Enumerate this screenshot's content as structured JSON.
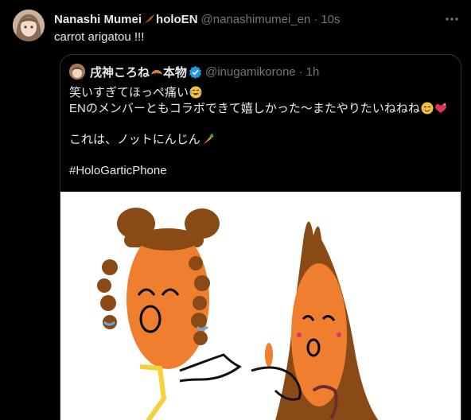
{
  "tweet": {
    "author_name": "Nanashi Mumei",
    "author_suffix": "holoEN",
    "handle": "@nanashimumei_en",
    "separator": "·",
    "time": "10s",
    "text": "carrot arigatou !!!"
  },
  "quote": {
    "author_name": "戌神ころね",
    "author_suffix": "本物",
    "handle": "@inugamikorone",
    "separator": "·",
    "time": "1h",
    "lines": [
      "笑いすぎてほっぺ痛い",
      "ENのメンバーともコラボできて嬉しかった～またやりたいねねね",
      "",
      "これは、ノットにんじん",
      "",
      "#HoloGarticPhone"
    ]
  },
  "colors": {
    "background": "#000000",
    "text": "#e7e9ea",
    "muted": "#71767b",
    "border": "#2f3336",
    "verified": "#1d9bf0",
    "carrot": "#ef7f2e",
    "brown": "#8a4a16"
  },
  "icons": [
    "feather-icon",
    "more-icon",
    "croissant-icon",
    "verified-icon",
    "tears-of-joy-icon",
    "smile-icon",
    "sparkling-heart-icon",
    "carrot-icon"
  ]
}
